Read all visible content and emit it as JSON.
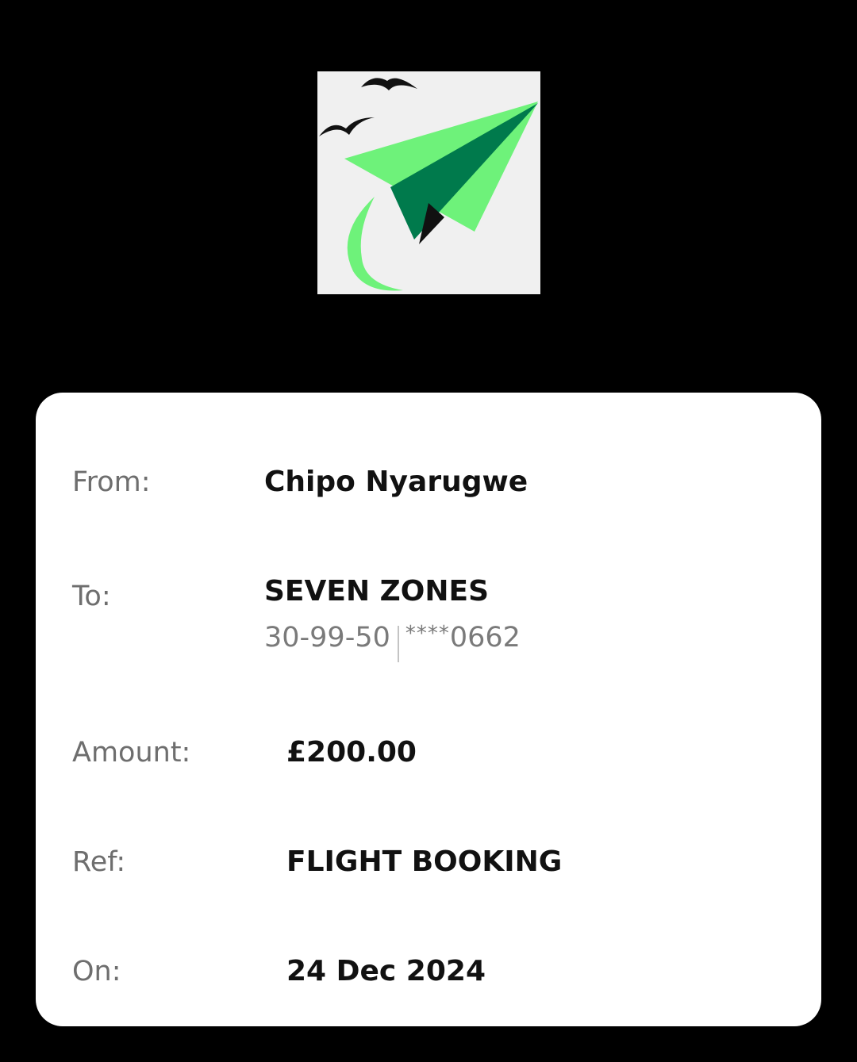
{
  "logo": {
    "name": "paper-plane-logo",
    "colors": {
      "background": "#f0f0f0",
      "light_green": "#6ef27a",
      "dark_green": "#007a4c",
      "birds": "#111111"
    }
  },
  "receipt": {
    "from": {
      "label": "From:",
      "value": "Chipo Nyarugwe"
    },
    "to": {
      "label": "To:",
      "value": "SEVEN ZONES",
      "sort_code": "30-99-50",
      "account_mask": "****",
      "account_last4": "0662"
    },
    "amount": {
      "label": "Amount:",
      "value": "£200.00"
    },
    "ref": {
      "label": "Ref:",
      "value": "FLIGHT BOOKING"
    },
    "on": {
      "label": "On:",
      "value": "24 Dec 2024"
    }
  }
}
